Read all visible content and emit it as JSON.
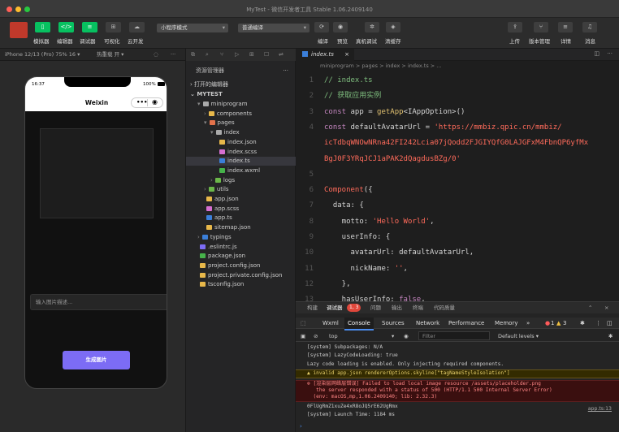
{
  "window": {
    "title": "MyTest - 微信开发者工具 Stable 1.06.2409140"
  },
  "toolbar": {
    "left_labels": [
      "模拟器",
      "编辑器",
      "调试器",
      "可视化",
      "云开发"
    ],
    "mode_select": "小程序模式",
    "compile_select": "普通编译",
    "center_labels": [
      "编译",
      "预览",
      "真机调试",
      "清缓存"
    ],
    "right_labels": [
      "上传",
      "版本管理",
      "详情",
      "消息"
    ]
  },
  "simulator": {
    "device": "iPhone 12/13 (Pro) 75% 16 ▾",
    "hotreload": "热重载 开 ▾",
    "time": "16:37",
    "battery": "100%",
    "nav_title": "Weixin",
    "input_placeholder": "输入图片描述...",
    "generate_button": "生成图片"
  },
  "explorer": {
    "header": "资源管理器",
    "open_editors": "打开的编辑器",
    "project": "MYTEST",
    "tree": [
      {
        "label": "miniprogram",
        "depth": 1,
        "kind": "folder-open",
        "color": "#aaaaaa"
      },
      {
        "label": "components",
        "depth": 2,
        "kind": "folder",
        "color": "#e8b84a"
      },
      {
        "label": "pages",
        "depth": 2,
        "kind": "folder-open",
        "color": "#e2724b"
      },
      {
        "label": "index",
        "depth": 3,
        "kind": "folder-open",
        "color": "#aaaaaa"
      },
      {
        "label": "index.json",
        "depth": 4,
        "kind": "file",
        "color": "#e8b84a"
      },
      {
        "label": "index.scss",
        "depth": 4,
        "kind": "file",
        "color": "#d66fd1"
      },
      {
        "label": "index.ts",
        "depth": 4,
        "kind": "file",
        "color": "#3b7fd9"
      },
      {
        "label": "index.wxml",
        "depth": 4,
        "kind": "file",
        "color": "#46b34a"
      },
      {
        "label": "logs",
        "depth": 3,
        "kind": "folder",
        "color": "#6cb84a"
      },
      {
        "label": "utils",
        "depth": 2,
        "kind": "folder",
        "color": "#6cb84a"
      },
      {
        "label": "app.json",
        "depth": 2,
        "kind": "file",
        "color": "#e8b84a"
      },
      {
        "label": "app.scss",
        "depth": 2,
        "kind": "file",
        "color": "#d66fd1"
      },
      {
        "label": "app.ts",
        "depth": 2,
        "kind": "file",
        "color": "#3b7fd9"
      },
      {
        "label": "sitemap.json",
        "depth": 2,
        "kind": "file",
        "color": "#e8b84a"
      },
      {
        "label": "typings",
        "depth": 1,
        "kind": "folder",
        "color": "#3b7fd9"
      },
      {
        "label": ".eslintrc.js",
        "depth": 1,
        "kind": "file",
        "color": "#7c6cf5"
      },
      {
        "label": "package.json",
        "depth": 1,
        "kind": "file",
        "color": "#46b34a"
      },
      {
        "label": "project.config.json",
        "depth": 1,
        "kind": "file",
        "color": "#e8b84a"
      },
      {
        "label": "project.private.config.json",
        "depth": 1,
        "kind": "file",
        "color": "#e8b84a"
      },
      {
        "label": "tsconfig.json",
        "depth": 1,
        "kind": "file",
        "color": "#e8b84a"
      }
    ]
  },
  "editor": {
    "tab": "index.ts",
    "breadcrumb": "miniprogram > pages > index > index.ts > ...",
    "lines": [
      {
        "n": "1",
        "segs": [
          {
            "t": "// index.ts",
            "c": "cm"
          }
        ]
      },
      {
        "n": "2",
        "segs": [
          {
            "t": "// 获取应用实例",
            "c": "cm"
          }
        ]
      },
      {
        "n": "3",
        "segs": [
          {
            "t": "const ",
            "c": "kw"
          },
          {
            "t": "app = ",
            "c": ""
          },
          {
            "t": "getApp",
            "c": "fn"
          },
          {
            "t": "<IAppOption>()",
            "c": ""
          }
        ]
      },
      {
        "n": "4",
        "segs": [
          {
            "t": "const ",
            "c": "kw"
          },
          {
            "t": "defaultAvatarUrl = ",
            "c": ""
          },
          {
            "t": "'https://mmbiz.qpic.cn/mmbiz/",
            "c": "str"
          }
        ]
      },
      {
        "n": "",
        "segs": [
          {
            "t": "icTdbqWNOwNRna42FI242Lcia07jQodd2FJGIYQfG0LAJGFxM4FbnQP6yfMx",
            "c": "str"
          }
        ]
      },
      {
        "n": "",
        "segs": [
          {
            "t": "BgJ0F3YRqJCJ1aPAK2dQagdusBZg/0'",
            "c": "str"
          }
        ]
      },
      {
        "n": "5",
        "segs": [
          {
            "t": "",
            "c": ""
          }
        ]
      },
      {
        "n": "6",
        "segs": [
          {
            "t": "Component",
            "c": "pl"
          },
          {
            "t": "({",
            "c": ""
          }
        ]
      },
      {
        "n": "7",
        "segs": [
          {
            "t": "  data: {",
            "c": ""
          }
        ]
      },
      {
        "n": "8",
        "segs": [
          {
            "t": "    motto: ",
            "c": ""
          },
          {
            "t": "'Hello World'",
            "c": "str"
          },
          {
            "t": ",",
            "c": ""
          }
        ]
      },
      {
        "n": "9",
        "segs": [
          {
            "t": "    userInfo: {",
            "c": ""
          }
        ]
      },
      {
        "n": "10",
        "segs": [
          {
            "t": "      avatarUrl: defaultAvatarUrl,",
            "c": ""
          }
        ]
      },
      {
        "n": "11",
        "segs": [
          {
            "t": "      nickName: ",
            "c": ""
          },
          {
            "t": "''",
            "c": "str"
          },
          {
            "t": ",",
            "c": ""
          }
        ]
      },
      {
        "n": "12",
        "segs": [
          {
            "t": "    },",
            "c": ""
          }
        ]
      },
      {
        "n": "13",
        "segs": [
          {
            "t": "    hasUserInfo: ",
            "c": ""
          },
          {
            "t": "false",
            "c": "kw"
          },
          {
            "t": ",",
            "c": ""
          }
        ]
      }
    ]
  },
  "devtools": {
    "top_tabs": [
      "构建",
      "调试器",
      "问题",
      "输出",
      "终端",
      "代码质量"
    ],
    "debugger_badge": "1, 3",
    "tabs": [
      "Wxml",
      "Console",
      "Sources",
      "Network",
      "Performance",
      "Memory",
      "»"
    ],
    "error_count": "1",
    "warn_count": "3",
    "context": "top",
    "filter_placeholder": "Filter",
    "levels": "Default levels ▾",
    "messages": [
      {
        "type": "log",
        "text": "[system] Subpackages: N/A"
      },
      {
        "type": "log",
        "text": "[system] LazyCodeLoading: true"
      },
      {
        "type": "log",
        "text": "Lazy code loading is enabled. Only injecting required components."
      },
      {
        "type": "warn",
        "text": "▲ invalid app.json rendererOptions.skyline[\"tagNameStyleIsolation\"]"
      },
      {
        "type": "err",
        "text": "⊗ [渲染层网络层错误] Failed to load local image resource /assets/placeholder.png\n   the server responded with a status of 500 (HTTP/1.1 500 Internal Server Error)\n  (env: macOS,mp,1.06.2409140; lib: 2.32.3)"
      },
      {
        "type": "log",
        "text": "0FlUgRmZ1xuZe4xR8oJQ5rE62UgRmx"
      },
      {
        "type": "log",
        "text": "[system] Launch Time: 1184 ms"
      }
    ],
    "source_link": "app.ts:13"
  },
  "colors": {
    "accent": "#07c160",
    "button": "#7c6cf5"
  }
}
